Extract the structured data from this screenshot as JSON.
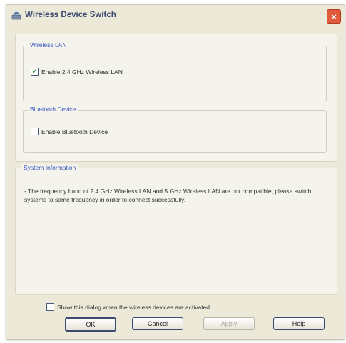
{
  "window": {
    "title": "Wireless Device Switch",
    "close_label": "×"
  },
  "wireless_lan": {
    "legend": "Wireless LAN",
    "checkbox_label": "Enable 2.4 GHz Wireless LAN",
    "checked": true
  },
  "bluetooth": {
    "legend": "Bluetooth Device",
    "checkbox_label": "Enable Bluetooth Device",
    "checked": false
  },
  "system_information": {
    "legend": "System Information",
    "text": "- The frequency band of 2.4 GHz Wireless LAN and 5 GHz Wireless LAN are not compatible, please switch systems to same frequency in order to connect successfully."
  },
  "show_dialog": {
    "label": "Show this dialog when the wireless devices are activated",
    "checked": false
  },
  "buttons": {
    "ok": "OK",
    "cancel": "Cancel",
    "apply": "Apply",
    "help": "Help"
  },
  "colors": {
    "legend": "#3a56c0",
    "close": "#e25a3c",
    "background": "#ece9d8"
  }
}
